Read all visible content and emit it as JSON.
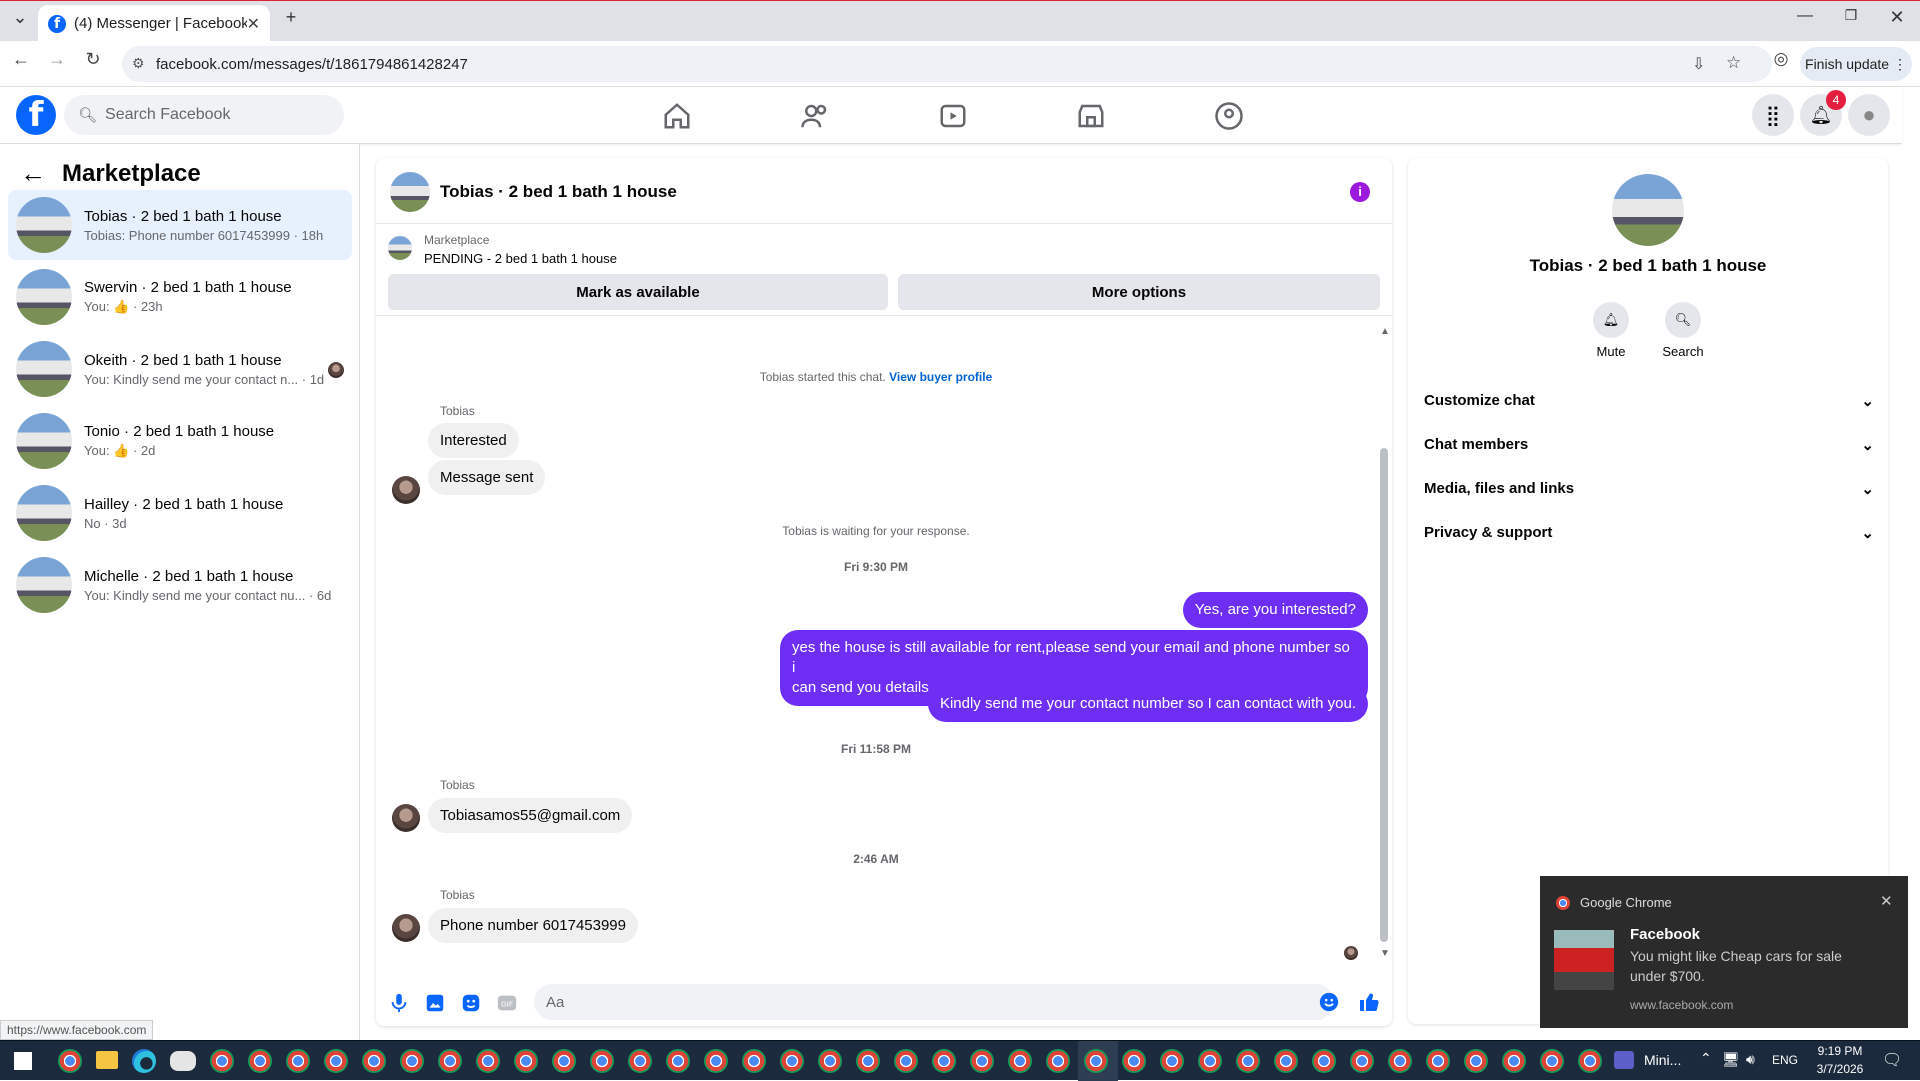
{
  "browser": {
    "tab_title": "(4) Messenger | Facebook",
    "url": "facebook.com/messages/t/1861794861428247",
    "finish_update": "Finish update"
  },
  "fb": {
    "search_placeholder": "Search Facebook",
    "notif_count": "4"
  },
  "left": {
    "title": "Marketplace",
    "conversations": [
      {
        "name": "Tobias · 2 bed 1 bath 1 house",
        "preview": "Tobias: Phone number 6017453999 · 18h"
      },
      {
        "name": "Swervin · 2 bed 1 bath 1 house",
        "preview": "You: 👍 · 23h"
      },
      {
        "name": "Okeith · 2 bed 1 bath 1 house",
        "preview": "You: Kindly send me your contact n...  · 1d"
      },
      {
        "name": "Tonio · 2 bed 1 bath 1 house",
        "preview": "You: 👍 · 2d"
      },
      {
        "name": "Hailley · 2 bed 1 bath 1 house",
        "preview": "No · 3d"
      },
      {
        "name": "Michelle · 2 bed 1 bath 1 house",
        "preview": "You: Kindly send me your contact nu...  · 6d"
      }
    ]
  },
  "chat": {
    "title": "Tobias · 2 bed 1 bath 1 house",
    "marketplace_label": "Marketplace",
    "listing_status": "PENDING - 2 bed 1 bath 1 house",
    "mark_available": "Mark as available",
    "more_options": "More options",
    "started": "Tobias started this chat.",
    "view_profile": "View buyer profile",
    "sender": "Tobias",
    "msg_in_1": "Interested",
    "msg_in_2": "Message sent",
    "waiting": "Tobias is waiting for your response.",
    "time_1": "Fri 9:30 PM",
    "msg_out_1": "Yes, are you interested?",
    "msg_out_2a": "yes the house is still available for rent,please send your email and phone number so i",
    "msg_out_2b": "can send you details",
    "msg_out_3": "Kindly send me your contact number so I can contact with you.",
    "time_2": "Fri 11:58 PM",
    "msg_in_3": "Tobiasamos55@gmail.com",
    "time_3": "2:46 AM",
    "msg_in_4": "Phone number 6017453999",
    "composer_placeholder": "Aa"
  },
  "right": {
    "title": "Tobias · 2 bed 1 bath 1 house",
    "mute": "Mute",
    "search": "Search",
    "sections": [
      "Customize chat",
      "Chat members",
      "Media, files and links",
      "Privacy & support"
    ]
  },
  "toast": {
    "app": "Google Chrome",
    "title": "Facebook",
    "body1": "You might like Cheap cars for sale",
    "body2": "under $700.",
    "site": "www.facebook.com"
  },
  "status_url": "https://www.facebook.com",
  "taskbar": {
    "mini": "Mini...",
    "lang": "ENG",
    "time": "9:19 PM",
    "date": "3/7/2026"
  }
}
